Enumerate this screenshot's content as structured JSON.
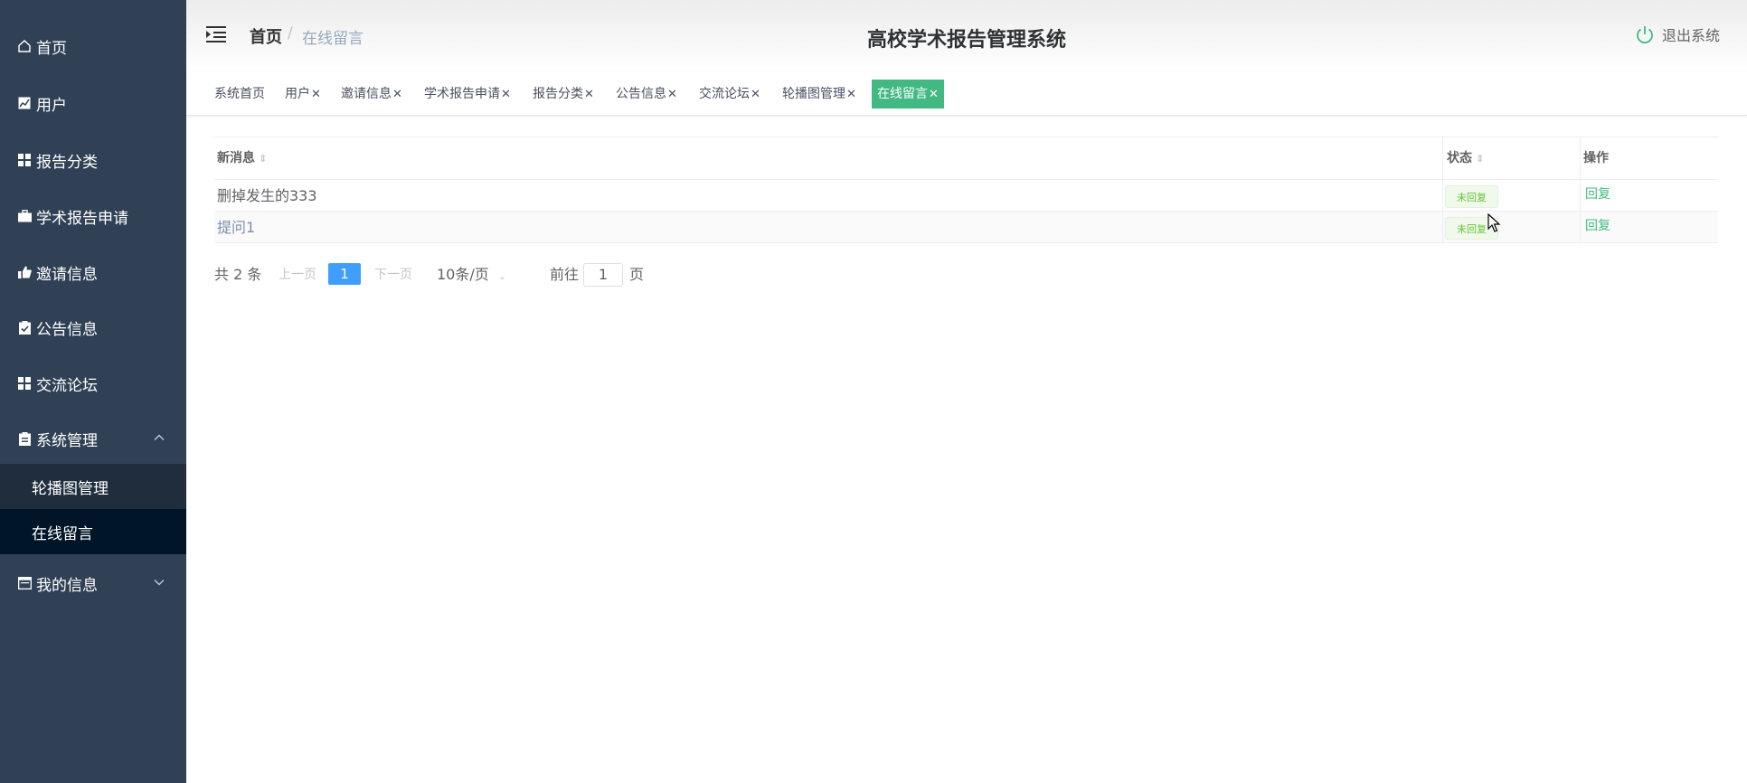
{
  "sidebar": {
    "items": [
      {
        "label": "首页",
        "icon": "home-icon"
      },
      {
        "label": "用户",
        "icon": "chart-icon"
      },
      {
        "label": "报告分类",
        "icon": "grid-icon"
      },
      {
        "label": "学术报告申请",
        "icon": "briefcase-icon"
      },
      {
        "label": "邀请信息",
        "icon": "thumb-icon"
      },
      {
        "label": "公告信息",
        "icon": "clipboard-check-icon"
      },
      {
        "label": "交流论坛",
        "icon": "grid-icon"
      },
      {
        "label": "系统管理",
        "icon": "clipboard-icon"
      }
    ],
    "system_submenu": [
      "轮播图管理",
      "在线留言"
    ],
    "my_info": "我的信息"
  },
  "header": {
    "breadcrumb_home": "首页",
    "breadcrumb_sep": "/",
    "breadcrumb_current": "在线留言",
    "title": "高校学术报告管理系统",
    "logout": "退出系统"
  },
  "tags": [
    {
      "label": "系统首页",
      "closable": false
    },
    {
      "label": "用户",
      "closable": true
    },
    {
      "label": "邀请信息",
      "closable": true
    },
    {
      "label": "学术报告申请",
      "closable": true
    },
    {
      "label": "报告分类",
      "closable": true
    },
    {
      "label": "公告信息",
      "closable": true
    },
    {
      "label": "交流论坛",
      "closable": true
    },
    {
      "label": "轮播图管理",
      "closable": true
    },
    {
      "label": "在线留言",
      "closable": true,
      "active": true
    }
  ],
  "table": {
    "columns": [
      "新消息",
      "状态",
      "操作"
    ],
    "rows": [
      {
        "message": "删掉发生的333",
        "status": "未回复",
        "action": "回复"
      },
      {
        "message": "提问1",
        "status": "未回复",
        "action": "回复"
      }
    ]
  },
  "pagination": {
    "total": "共 2 条",
    "prev": "上一页",
    "page": "1",
    "next": "下一页",
    "page_size": "10条/页",
    "goto": "前往",
    "goto_value": "1",
    "page_unit": "页"
  },
  "colors": {
    "sidebar_bg": "#304156",
    "submenu_bg": "#1f2d3d",
    "submenu_active_bg": "#001528",
    "accent": "#42b983",
    "pager_active": "#409eff"
  }
}
